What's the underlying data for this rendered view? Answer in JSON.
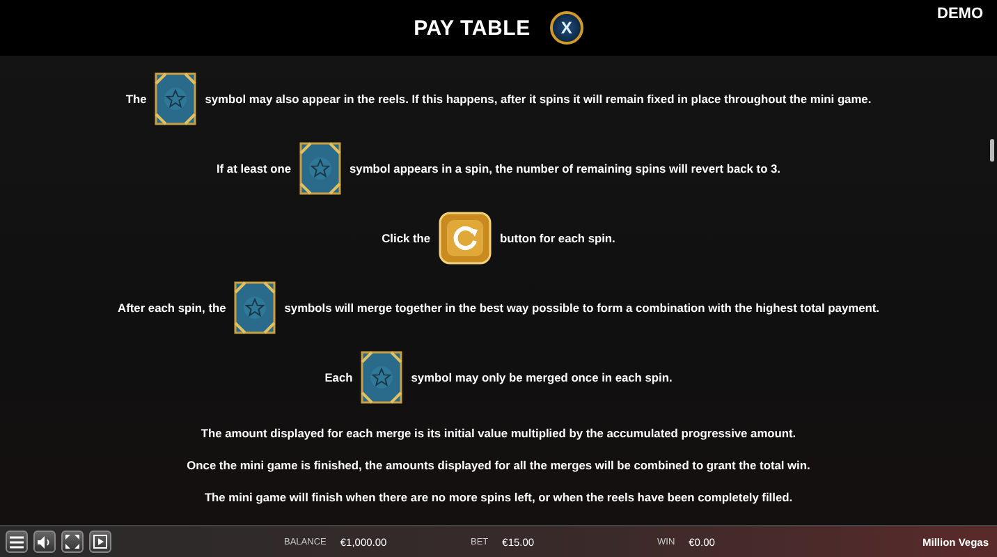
{
  "header": {
    "title": "PAY TABLE",
    "close": "X",
    "mode": "DEMO"
  },
  "lines": [
    {
      "before": "The",
      "kind": "symbol",
      "after": "symbol may also appear in the reels. If this happens, after it spins it will remain fixed in place throughout the mini game."
    },
    {
      "before": "If at least one",
      "kind": "symbol",
      "after": "symbol appears in a spin, the number of remaining spins will revert back to 3."
    },
    {
      "before": "Click the",
      "kind": "spin-button",
      "after": "button for each spin."
    },
    {
      "before": "After each spin, the",
      "kind": "symbol",
      "after": "symbols will merge together in the best way possible to form a combination with the highest total payment."
    },
    {
      "before": "Each",
      "kind": "symbol",
      "after": "symbol may only be merged once in each spin."
    }
  ],
  "paragraphs": [
    "The amount displayed for each merge is its initial value multiplied by the accumulated progressive amount.",
    "Once the mini game is finished, the amounts displayed for all the merges will be combined to grant the total win.",
    "The mini game will finish when there are no more spins left, or when the reels have been completely filled."
  ],
  "status_bar": {
    "stats": [
      {
        "label": "BALANCE",
        "value": "€1,000.00"
      },
      {
        "label": "BET",
        "value": "€15.00"
      },
      {
        "label": "WIN",
        "value": "€0.00"
      }
    ],
    "game": "Million Vegas"
  }
}
